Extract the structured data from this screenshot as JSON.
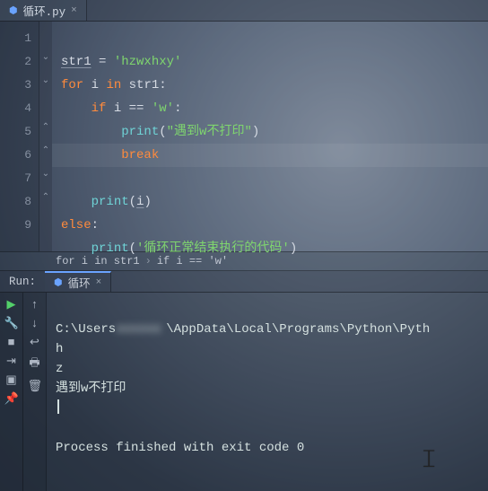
{
  "tab": {
    "name": "循环.py"
  },
  "editor": {
    "line_numbers": [
      "1",
      "2",
      "3",
      "4",
      "5",
      "6",
      "7",
      "8",
      "9"
    ],
    "code": {
      "l1_a": "str1",
      "l1_b": " = ",
      "l1_c": "'hzwxhxy'",
      "l2_a": "for",
      "l2_b": " i ",
      "l2_c": "in",
      "l2_d": " str1:",
      "l3_a": "if",
      "l3_b": " i == ",
      "l3_c": "'w'",
      "l3_d": ":",
      "l4_a": "print",
      "l4_b": "(",
      "l4_c": "\"遇到w不打印\"",
      "l4_d": ")",
      "l5_a": "break",
      "l6_a": "print",
      "l6_b": "(",
      "l6_c": "i",
      "l6_d": ")",
      "l7_a": "else",
      "l7_b": ":",
      "l8_a": "print",
      "l8_b": "(",
      "l8_c": "'循环正常结束执行的代码'",
      "l8_d": ")"
    }
  },
  "breadcrumb": {
    "item1": "for i in str1",
    "item2": "if i == 'w'"
  },
  "run": {
    "label": "Run:",
    "tab": "循环",
    "console": {
      "path_prefix": "C:\\Users",
      "path_suffix": "\\AppData\\Local\\Programs\\Python\\Pyth",
      "out1": "h",
      "out2": "z",
      "out3": "遇到w不打印",
      "exit": "Process finished with exit code 0"
    }
  }
}
